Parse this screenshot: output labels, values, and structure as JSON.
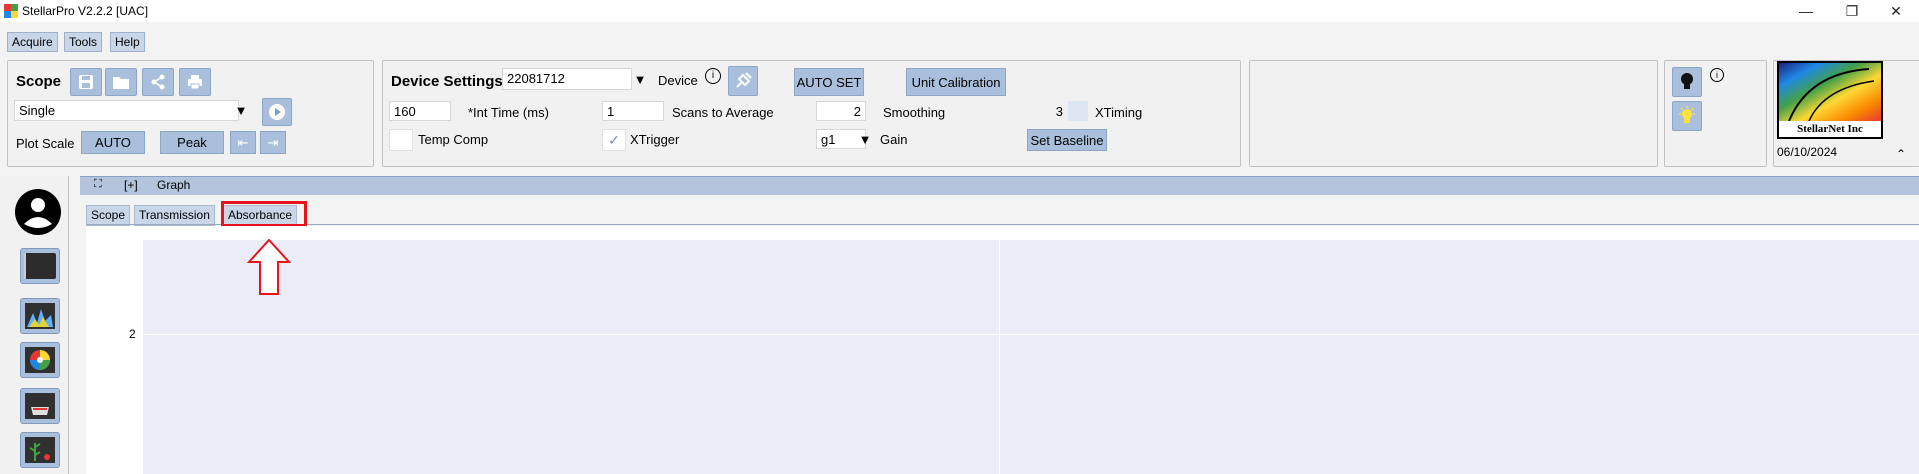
{
  "window": {
    "title": "StellarPro V2.2.2 [UAC]"
  },
  "menu": {
    "items": [
      "Acquire",
      "Tools",
      "Help"
    ]
  },
  "scope": {
    "title": "Scope",
    "mode_value": "Single",
    "plot_scale_label": "Plot Scale",
    "auto_label": "AUTO",
    "peak_label": "Peak"
  },
  "device_settings": {
    "title": "Device Settings",
    "device_id": "22081712",
    "device_label": "Device",
    "auto_set_label": "AUTO SET",
    "unit_calibration_label": "Unit Calibration",
    "int_time_value": "160",
    "int_time_label": "*Int Time (ms)",
    "scans_value": "1",
    "scans_label": "Scans to Average",
    "smoothing_value": "2",
    "smoothing_label": "Smoothing",
    "xtiming_value": "3",
    "xtiming_label": "XTiming",
    "temp_comp_label": "Temp Comp",
    "xtrigger_label": "XTrigger",
    "gain_value": "g1",
    "gain_label": "Gain",
    "set_baseline_label": "Set Baseline"
  },
  "logo": {
    "text": "StellarNet Inc",
    "date": "06/10/2024"
  },
  "graph": {
    "header_expand": "[+]",
    "header_label": "Graph",
    "tabs": [
      "Scope",
      "Transmission",
      "Absorbance"
    ],
    "active_tab": "Absorbance",
    "y_tick": "2"
  },
  "icons": {
    "save": "save-icon",
    "open": "folder-icon",
    "share": "share-icon",
    "print": "print-icon",
    "play": "play-icon",
    "info": "info-icon",
    "usb": "usb-plug-icon",
    "bulb_dark": "lightbulb-off-icon",
    "bulb_light": "lightbulb-on-icon",
    "avatar": "user-avatar-icon"
  },
  "colors": {
    "accent": "#a9bfdc",
    "highlight": "#e8141b",
    "plot_bg": "#eaedf8"
  }
}
